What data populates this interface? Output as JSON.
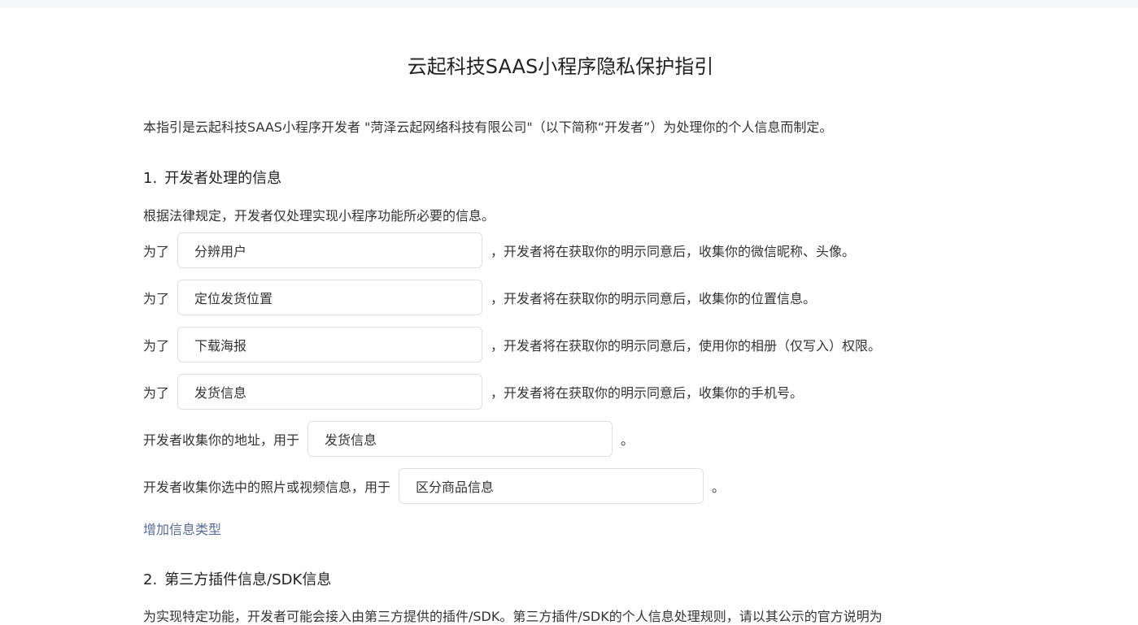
{
  "title": "云起科技SAAS小程序隐私保护指引",
  "intro": "本指引是云起科技SAAS小程序开发者 \"菏泽云起网络科技有限公司\"（以下简称“开发者”）为处理你的个人信息而制定。",
  "section1": {
    "number": "1.",
    "heading": "开发者处理的信息",
    "description": "根据法律规定，开发者仅处理实现小程序功能所必要的信息。",
    "rows": [
      {
        "prefix": "为了",
        "value": "分辨用户",
        "suffix": "，开发者将在获取你的明示同意后，收集你的微信昵称、头像。"
      },
      {
        "prefix": "为了",
        "value": "定位发货位置",
        "suffix": "，开发者将在获取你的明示同意后，收集你的位置信息。"
      },
      {
        "prefix": "为了",
        "value": "下载海报",
        "suffix": "，开发者将在获取你的明示同意后，使用你的相册（仅写入）权限。"
      },
      {
        "prefix": "为了",
        "value": "发货信息",
        "suffix": "，开发者将在获取你的明示同意后，收集你的手机号。"
      }
    ],
    "address_row": {
      "prefix": "开发者收集你的地址，用于",
      "value": "发货信息",
      "suffix": "。"
    },
    "media_row": {
      "prefix": "开发者收集你选中的照片或视频信息，用于",
      "value": "区分商品信息",
      "suffix": "。"
    },
    "add_link": "增加信息类型"
  },
  "section2": {
    "number": "2.",
    "heading": "第三方插件信息/SDK信息",
    "text": "为实现特定功能，开发者可能会接入由第三方提供的插件/SDK。第三方插件/SDK的个人信息处理规则，请以其公示的官方说明为"
  },
  "colors": {
    "link": "#576b95",
    "border": "#dcdfe6",
    "top_strip": "#f5f6f8"
  }
}
